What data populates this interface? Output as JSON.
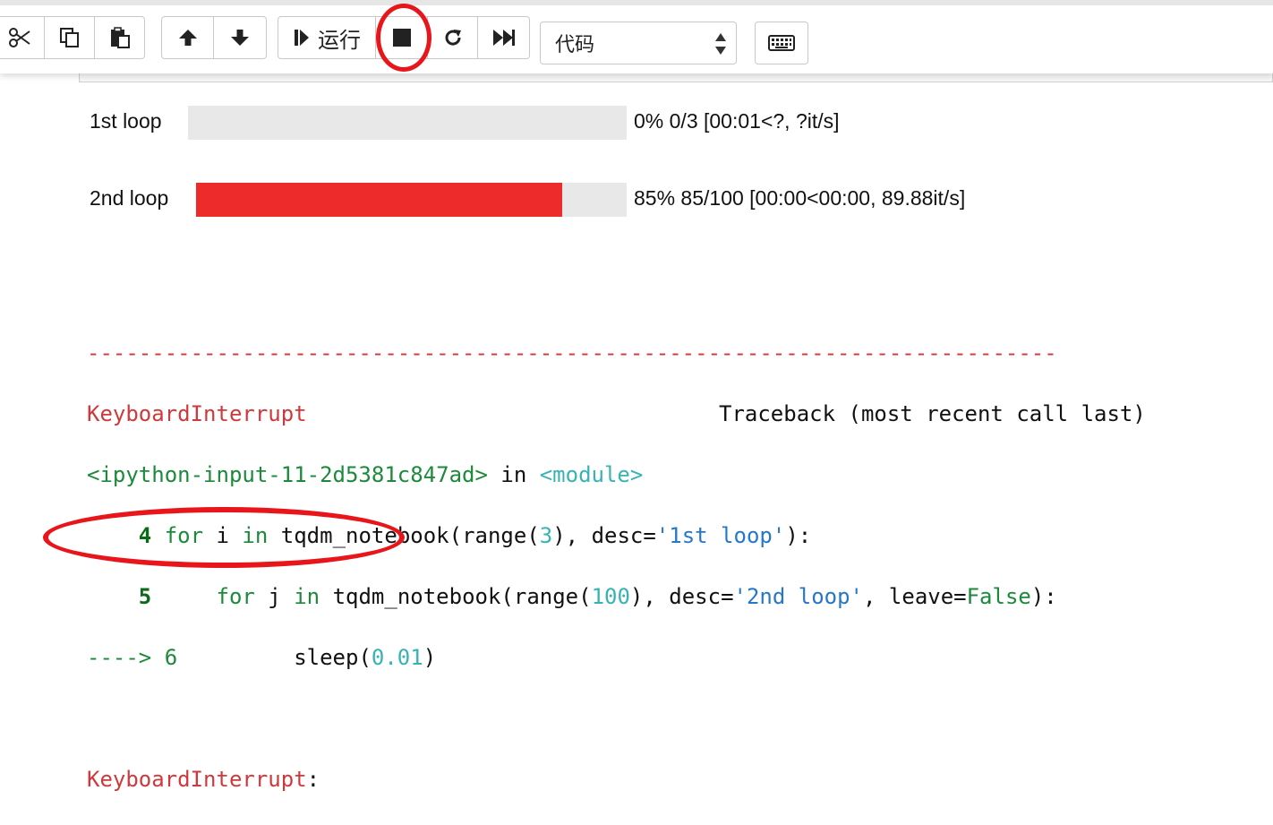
{
  "toolbar": {
    "run_label": "运行",
    "cell_type": "代码"
  },
  "progress": {
    "loop1": {
      "label": "1st loop",
      "fraction": 0.0,
      "text": "0% 0/3 [00:01<?, ?it/s]"
    },
    "loop2": {
      "label": "2nd loop",
      "fraction": 0.85,
      "text": "85% 85/100 [00:00<00:00, 89.88it/s]"
    }
  },
  "traceback": {
    "separator": "---------------------------------------------------------------------------",
    "error_name": "KeyboardInterrupt",
    "header_right": "Traceback (most recent call last)",
    "input_ref": "<ipython-input-11-2d5381c847ad>",
    "in_word": " in ",
    "module": "<module>",
    "line4_num": "4",
    "line5_num": "5",
    "line6_arrow": "----> 6",
    "final_error": "KeyboardInterrupt",
    "final_colon": ":"
  },
  "colors": {
    "progress_fill": "#ee2b2b",
    "annotation_ring": "#e8151b"
  }
}
